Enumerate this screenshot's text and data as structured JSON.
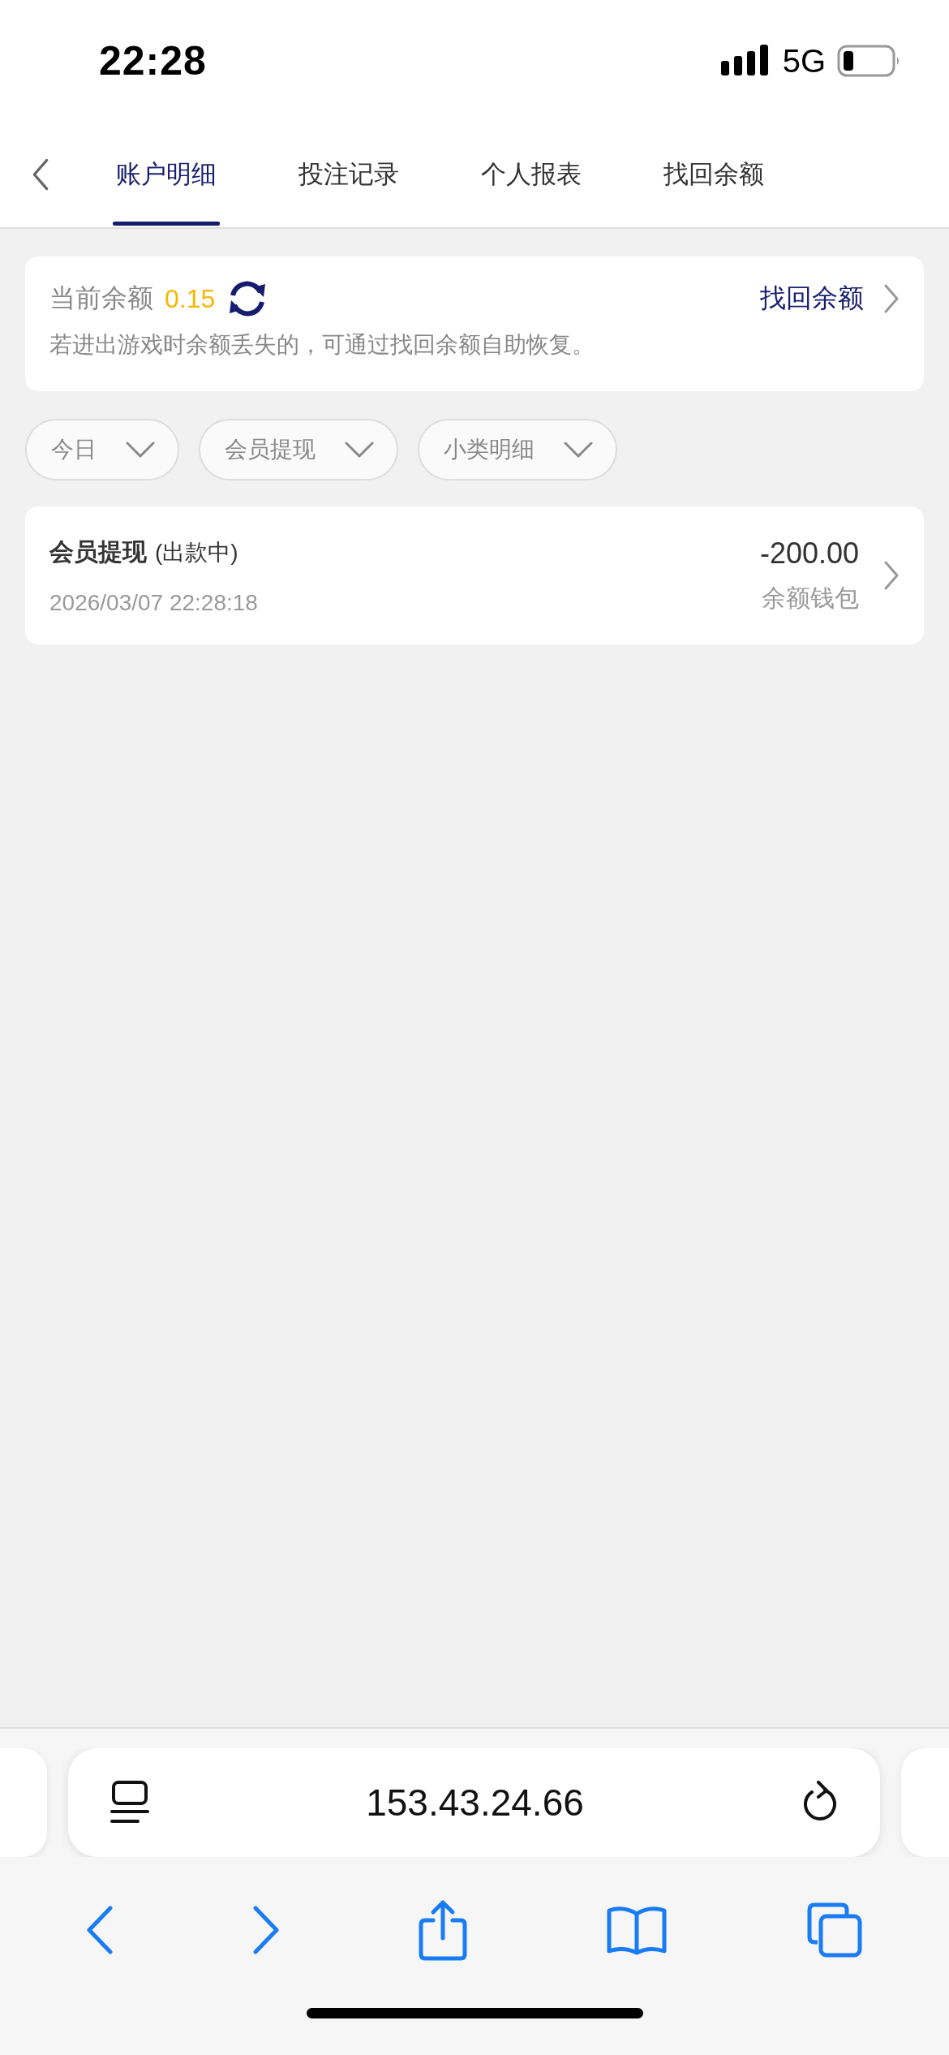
{
  "status_bar": {
    "time": "22:28",
    "network": "5G"
  },
  "tabs": [
    {
      "label": "账户明细",
      "selected": true
    },
    {
      "label": "投注记录",
      "selected": false
    },
    {
      "label": "个人报表",
      "selected": false
    },
    {
      "label": "找回余额",
      "selected": false
    }
  ],
  "balance": {
    "label": "当前余额",
    "amount": "0.15",
    "link": "找回余额",
    "hint": "若进出游戏时余额丢失的，可通过找回余额自助恢复。"
  },
  "filters": [
    "今日",
    "会员提现",
    "小类明细"
  ],
  "records": [
    {
      "title": "会员提现",
      "status": "(出款中)",
      "time": "2026/03/07 22:28:18",
      "amount": "-200.00",
      "wallet": "余额钱包"
    }
  ],
  "browser": {
    "url": "153.43.24.66"
  }
}
